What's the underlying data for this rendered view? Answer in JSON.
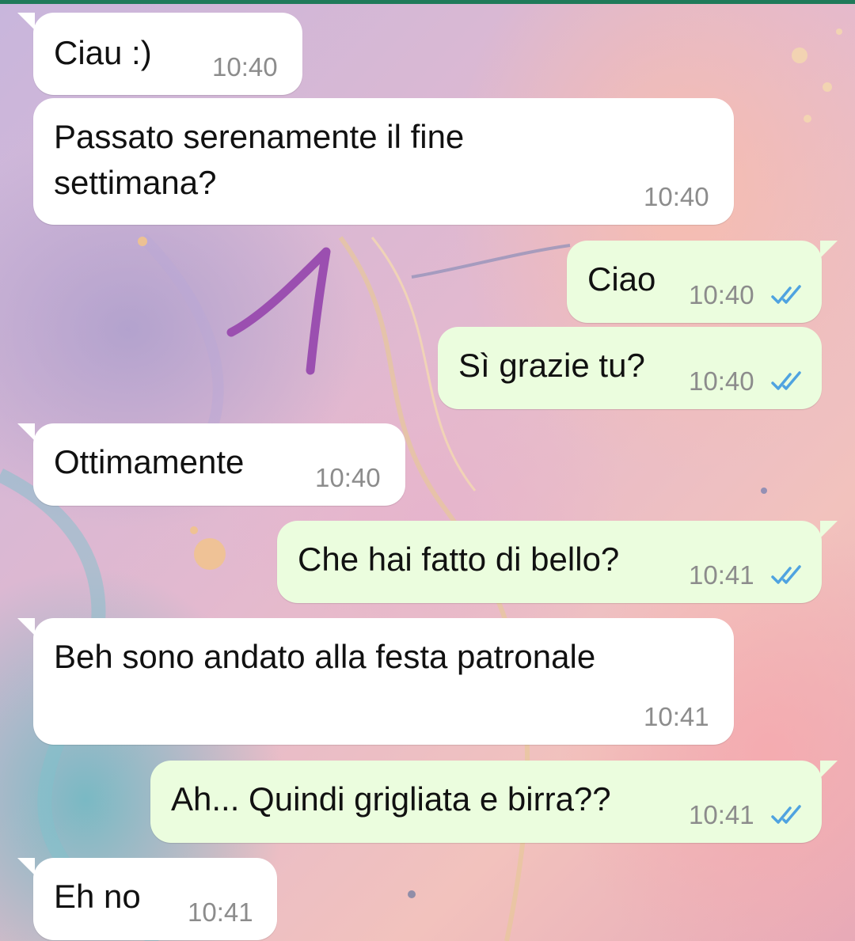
{
  "colors": {
    "incoming_bubble": "#ffffff",
    "outgoing_bubble": "#ebfdde",
    "timestamp": "#8c8c8c",
    "read_ticks": "#4fa3e0",
    "annotation_pen": "#9b4fb0",
    "top_bar": "#1f7a5a"
  },
  "messages": [
    {
      "direction": "incoming",
      "text": "Ciau :)",
      "time": "10:40"
    },
    {
      "direction": "incoming",
      "lines": [
        "Passato serenamente il fine",
        "settimana?"
      ],
      "time": "10:40"
    },
    {
      "direction": "outgoing",
      "text": "Ciao",
      "time": "10:40",
      "status": "read-double-check-icon"
    },
    {
      "direction": "outgoing",
      "text": "Sì grazie tu?",
      "time": "10:40",
      "status": "read-double-check-icon"
    },
    {
      "direction": "incoming",
      "text": "Ottimamente",
      "time": "10:40"
    },
    {
      "direction": "outgoing",
      "text": "Che hai fatto di bello?",
      "time": "10:41",
      "status": "read-double-check-icon"
    },
    {
      "direction": "incoming",
      "text": "Beh sono andato alla festa patronale",
      "time": "10:41"
    },
    {
      "direction": "outgoing",
      "text": "Ah... Quindi grigliata e birra??",
      "time": "10:41",
      "status": "read-double-check-icon"
    },
    {
      "direction": "incoming",
      "text": "Eh no",
      "time": "10:41"
    }
  ]
}
